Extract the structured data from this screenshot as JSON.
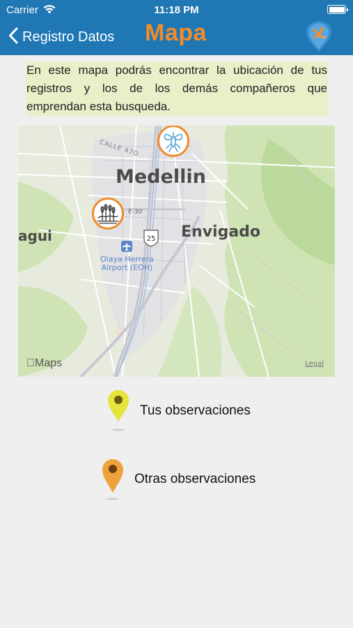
{
  "status_bar": {
    "carrier": "Carrier",
    "time": "11:18 PM"
  },
  "nav": {
    "back_label": "Registro Datos",
    "title": "Mapa"
  },
  "description": "En este mapa podrás encontrar la ubicación de tus registros y los de los demás compañeros que emprendan esta busqueda.",
  "map": {
    "city_label": "Medellin",
    "district_label": "Envigado",
    "west_label": "agui",
    "street_label": "CALLE 47D",
    "road_label": "E-30",
    "highway_shield": "25",
    "airport_label_1": "Olaya Herrera",
    "airport_label_2": "Airport (EOH)",
    "attribution": "Maps",
    "legal_link": "Legal"
  },
  "legend": {
    "own": "Tus observaciones",
    "others": "Otras observaciones"
  },
  "colors": {
    "header_bg": "#1f77b4",
    "title_accent": "#f08c2c",
    "own_pin": "#e4e43a",
    "other_pin": "#efa23b"
  }
}
